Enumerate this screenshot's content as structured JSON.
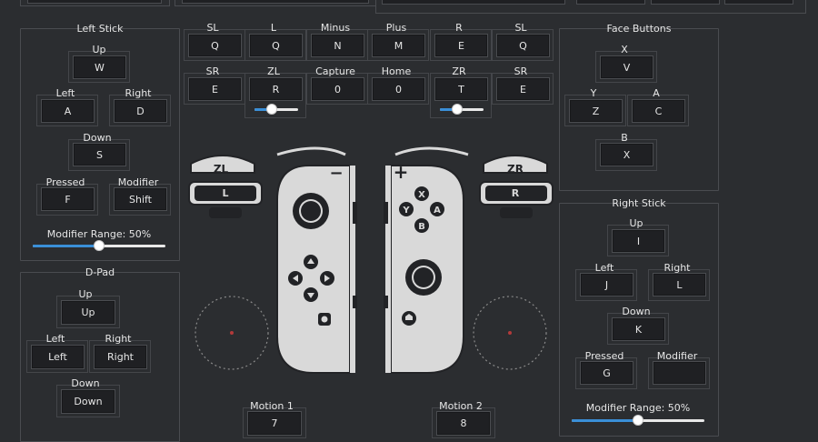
{
  "left_stick": {
    "title": "Left Stick",
    "up": {
      "label": "Up",
      "key": "W"
    },
    "left": {
      "label": "Left",
      "key": "A"
    },
    "right": {
      "label": "Right",
      "key": "D"
    },
    "down": {
      "label": "Down",
      "key": "S"
    },
    "pressed": {
      "label": "Pressed",
      "key": "F"
    },
    "modifier": {
      "label": "Modifier",
      "key": "Shift"
    },
    "modifier_range": {
      "label": "Modifier Range: 50%",
      "value_percent": 50
    }
  },
  "dpad": {
    "title": "D-Pad",
    "up": {
      "label": "Up",
      "key": "Up"
    },
    "left": {
      "label": "Left",
      "key": "Left"
    },
    "right": {
      "label": "Right",
      "key": "Right"
    },
    "down": {
      "label": "Down",
      "key": "Down"
    }
  },
  "center_top": {
    "row1": [
      {
        "label": "SL",
        "key": "Q"
      },
      {
        "label": "L",
        "key": "Q"
      },
      {
        "label": "Minus",
        "key": "N"
      },
      {
        "label": "Plus",
        "key": "M"
      },
      {
        "label": "R",
        "key": "E"
      },
      {
        "label": "SL",
        "key": "Q"
      }
    ],
    "row2": [
      {
        "label": "SR",
        "key": "E"
      },
      {
        "label": "ZL",
        "key": "R"
      },
      {
        "label": "Capture",
        "key": "0"
      },
      {
        "label": "Home",
        "key": "0"
      },
      {
        "label": "ZR",
        "key": "T"
      },
      {
        "label": "SR",
        "key": "E"
      }
    ],
    "zl_slider_percent": 40,
    "zr_slider_percent": 40
  },
  "face_buttons": {
    "title": "Face Buttons",
    "x": {
      "label": "X",
      "key": "V"
    },
    "y": {
      "label": "Y",
      "key": "Z"
    },
    "a": {
      "label": "A",
      "key": "C"
    },
    "b": {
      "label": "B",
      "key": "X"
    }
  },
  "right_stick": {
    "title": "Right Stick",
    "up": {
      "label": "Up",
      "key": "I"
    },
    "left": {
      "label": "Left",
      "key": "J"
    },
    "right": {
      "label": "Right",
      "key": "L"
    },
    "down": {
      "label": "Down",
      "key": "K"
    },
    "pressed": {
      "label": "Pressed",
      "key": "G"
    },
    "modifier": {
      "label": "Modifier",
      "key": ""
    },
    "modifier_range": {
      "label": "Modifier Range: 50%",
      "value_percent": 50
    }
  },
  "motion": {
    "motion1": {
      "label": "Motion 1",
      "key": "7"
    },
    "motion2": {
      "label": "Motion 2",
      "key": "8"
    }
  },
  "controller": {
    "zl_label": "ZL",
    "l_label": "L",
    "zr_label": "ZR",
    "r_label": "R",
    "minus_symbol": "−",
    "plus_symbol": "+",
    "x_label": "X",
    "y_label": "Y",
    "a_label": "A",
    "b_label": "B",
    "body_color": "#d9d9d9",
    "dark_color": "#222326"
  }
}
